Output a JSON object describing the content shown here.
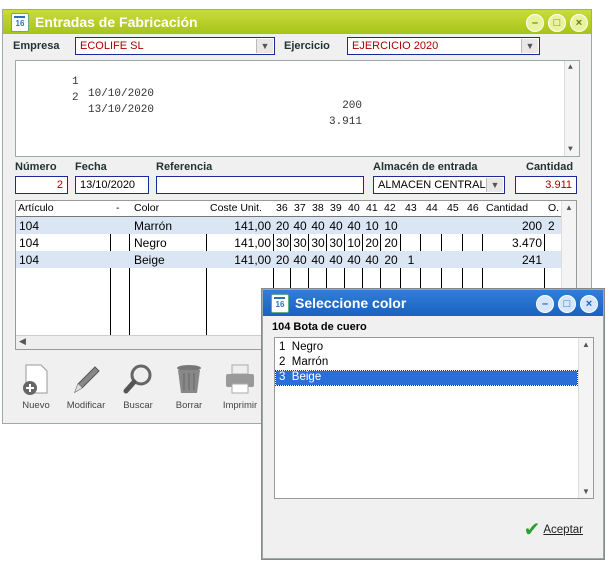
{
  "main": {
    "title": "Entradas de Fabricación",
    "empresa_label": "Empresa",
    "empresa_value": "ECOLIFE SL",
    "ejercicio_label": "Ejercicio",
    "ejercicio_value": "EJERCICIO 2020",
    "history": [
      {
        "n": "1",
        "date": "10/10/2020",
        "amount": "200"
      },
      {
        "n": "2",
        "date": "13/10/2020",
        "amount": "3.911"
      }
    ],
    "numero_label": "Número",
    "numero_value": "2",
    "fecha_label": "Fecha",
    "fecha_value": "13/10/2020",
    "referencia_label": "Referencia",
    "referencia_value": "",
    "almacen_label": "Almacén de entrada",
    "almacen_value": "ALMACEN CENTRAL",
    "cantidad_label": "Cantidad",
    "cantidad_value": "3.911",
    "grid_headers": [
      "Artículo",
      "-",
      "Color",
      "Coste Unit.",
      "36",
      "37",
      "38",
      "39",
      "40",
      "41",
      "42",
      "43",
      "44",
      "45",
      "46",
      "Cantidad",
      "O."
    ],
    "grid_rows": [
      {
        "articulo": "104",
        "color": "Marrón",
        "coste": "141,00",
        "sizes": [
          "20",
          "40",
          "40",
          "40",
          "40",
          "10",
          "10",
          "",
          "",
          "",
          ""
        ],
        "cantidad": "200",
        "o": "2"
      },
      {
        "articulo": "104",
        "color": "Negro",
        "coste": "141,00",
        "sizes": [
          "30",
          "30",
          "30",
          "30",
          "10",
          "20",
          "20",
          "",
          "",
          "",
          ""
        ],
        "cantidad": "3.470",
        "o": ""
      },
      {
        "articulo": "104",
        "color": "Beige",
        "coste": "141,00",
        "sizes": [
          "20",
          "40",
          "40",
          "40",
          "40",
          "40",
          "20",
          "1",
          "",
          "",
          ""
        ],
        "cantidad": "241",
        "o": ""
      }
    ],
    "toolbar": {
      "nuevo": "Nuevo",
      "modificar": "Modificar",
      "buscar": "Buscar",
      "borrar": "Borrar",
      "imprimir": "Imprimir"
    }
  },
  "dialog": {
    "title": "Seleccione color",
    "subtitle": "104 Bota de cuero",
    "options": [
      {
        "n": "1",
        "label": "Negro"
      },
      {
        "n": "2",
        "label": "Marrón"
      },
      {
        "n": "3",
        "label": "Beige"
      }
    ],
    "selected_index": 2,
    "accept_label": "Aceptar"
  }
}
